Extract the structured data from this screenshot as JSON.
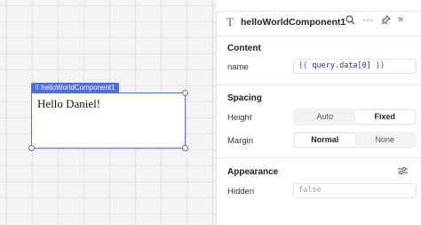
{
  "component": {
    "tag_label": "helloWorldComponent1",
    "text": "Hello Daniel!"
  },
  "inspector": {
    "type_icon": "T",
    "title": "helloWorldComponent1",
    "header_icons": [
      "search-icon",
      "more-icon",
      "pin-icon",
      "collapse-icon"
    ],
    "content": {
      "section_title": "Content",
      "name_label": "name",
      "name_value_open": "{{",
      "name_value_code": "query.data[0]",
      "name_value_close": "}}"
    },
    "spacing": {
      "section_title": "Spacing",
      "height_label": "Height",
      "height_options": [
        "Auto",
        "Fixed"
      ],
      "height_selected": "Fixed",
      "margin_label": "Margin",
      "margin_options": [
        "Normal",
        "None"
      ],
      "margin_selected": "Normal"
    },
    "appearance": {
      "section_title": "Appearance",
      "hidden_label": "Hidden",
      "hidden_value": "false"
    }
  }
}
